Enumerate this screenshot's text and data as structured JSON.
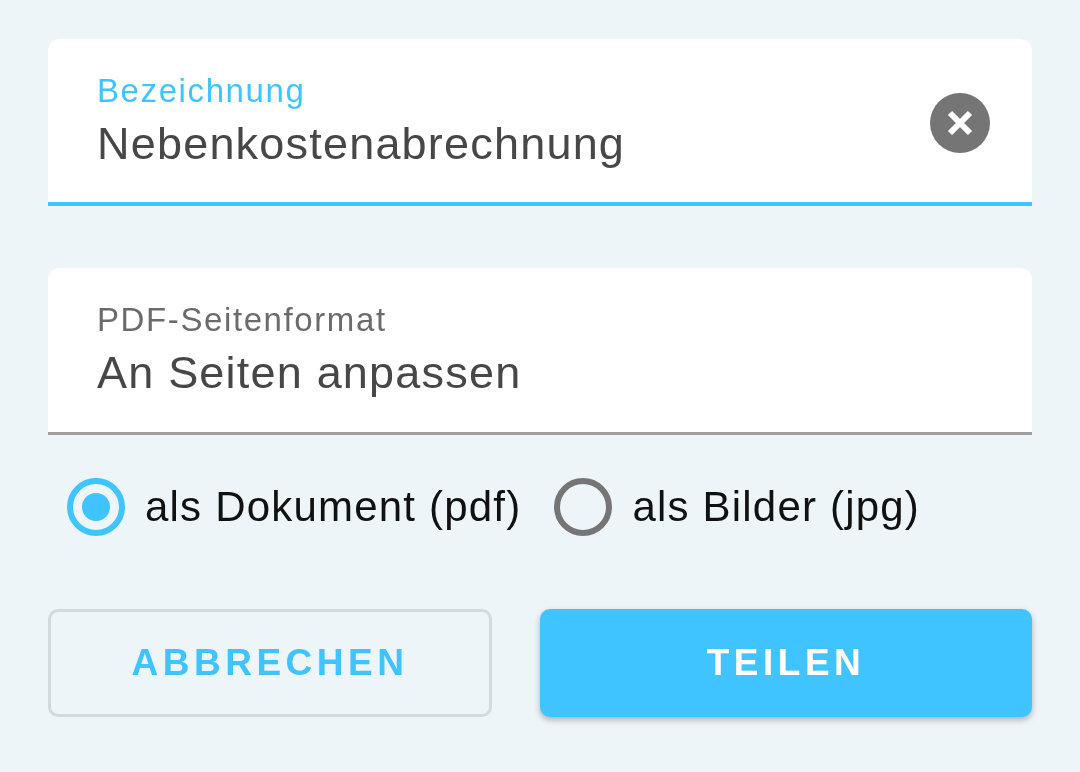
{
  "fields": [
    {
      "label": "Bezeichnung",
      "value": "Nebenkostenabrechnung",
      "focused": true,
      "clearable": true
    },
    {
      "label": "PDF-Seitenformat",
      "value": "An Seiten anpassen",
      "focused": false,
      "clearable": false
    }
  ],
  "export_format": [
    {
      "label": "als Dokument (pdf)",
      "selected": true
    },
    {
      "label": "als Bilder (jpg)",
      "selected": false
    }
  ],
  "buttons": [
    {
      "label": "ABBRECHEN",
      "kind": "outlined"
    },
    {
      "label": "TEILEN",
      "kind": "filled"
    }
  ]
}
